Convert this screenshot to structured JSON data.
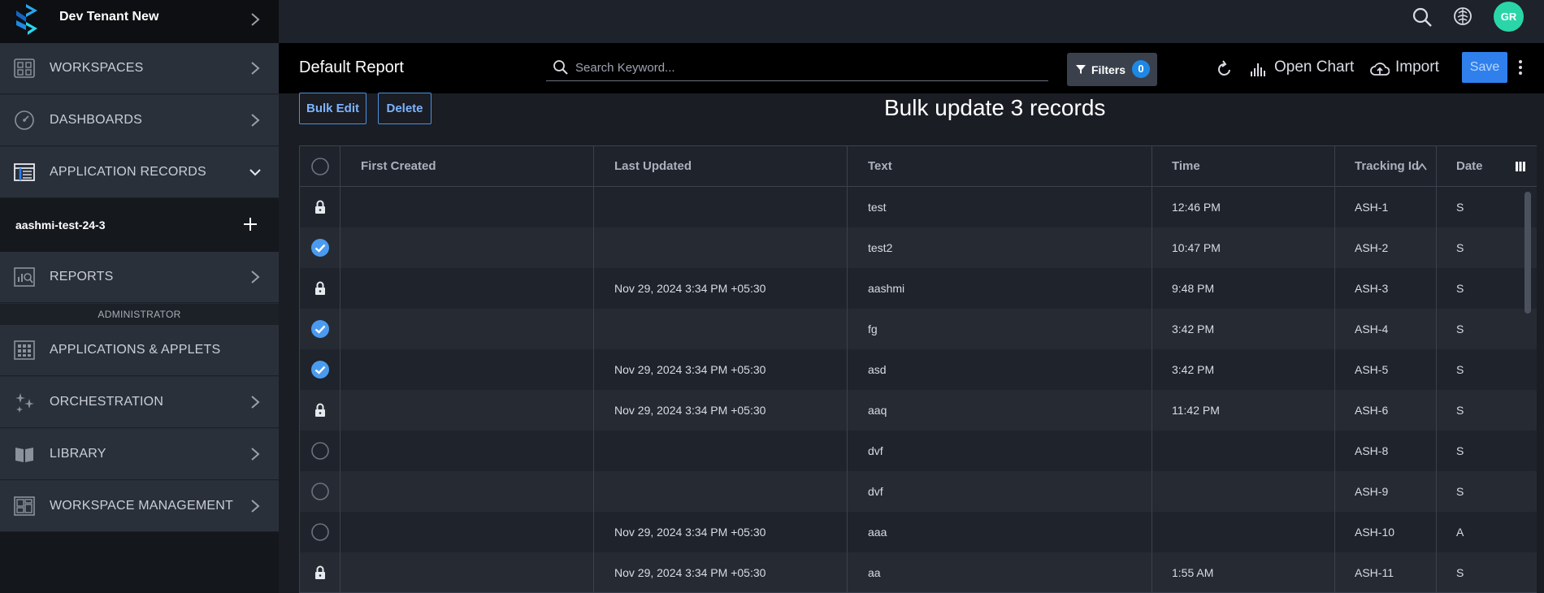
{
  "tenant": {
    "name": "Dev Tenant New"
  },
  "sidebar": {
    "items": [
      {
        "label": "WORKSPACES"
      },
      {
        "label": "DASHBOARDS"
      },
      {
        "label": "APPLICATION RECORDS"
      },
      {
        "label": "REPORTS"
      },
      {
        "label": "APPLICATIONS & APPLETS"
      },
      {
        "label": "ORCHESTRATION"
      },
      {
        "label": "LIBRARY"
      },
      {
        "label": "WORKSPACE MANAGEMENT"
      }
    ],
    "sub_item": "aashmi-test-24-3",
    "admin_header": "ADMINISTRATOR"
  },
  "topbar": {
    "avatar_initials": "GR"
  },
  "report": {
    "title": "Default Report",
    "search_placeholder": "Search Keyword...",
    "filters_label": "Filters",
    "filters_count": "0",
    "open_chart_label": "Open Chart",
    "import_label": "Import",
    "save_label": "Save"
  },
  "actions": {
    "bulk_edit_label": "Bulk Edit",
    "delete_label": "Delete",
    "bulk_title": "Bulk update 3 records"
  },
  "colors": {
    "accent": "#2f80ed",
    "avatar": "#2ad6a8",
    "check": "#4a9bf0"
  },
  "table": {
    "columns": [
      "First Created",
      "Last Updated",
      "Text",
      "Time",
      "Tracking Id",
      "Date"
    ],
    "rows": [
      {
        "state": "locked",
        "first_created": "",
        "last_updated": "",
        "text": "test",
        "time": "12:46 PM",
        "tracking_id": "ASH-1",
        "date": "S"
      },
      {
        "state": "checked",
        "first_created": "",
        "last_updated": "",
        "text": "test2",
        "time": "10:47 PM",
        "tracking_id": "ASH-2",
        "date": "S"
      },
      {
        "state": "locked",
        "first_created": "",
        "last_updated": "Nov 29, 2024 3:34 PM +05:30",
        "text": "aashmi",
        "time": "9:48 PM",
        "tracking_id": "ASH-3",
        "date": "S"
      },
      {
        "state": "checked",
        "first_created": "",
        "last_updated": "",
        "text": "fg",
        "time": "3:42 PM",
        "tracking_id": "ASH-4",
        "date": "S"
      },
      {
        "state": "checked",
        "first_created": "",
        "last_updated": "Nov 29, 2024 3:34 PM +05:30",
        "text": "asd",
        "time": "3:42 PM",
        "tracking_id": "ASH-5",
        "date": "S"
      },
      {
        "state": "locked",
        "first_created": "",
        "last_updated": "Nov 29, 2024 3:34 PM +05:30",
        "text": "aaq",
        "time": "11:42 PM",
        "tracking_id": "ASH-6",
        "date": "S"
      },
      {
        "state": "unchecked",
        "first_created": "",
        "last_updated": "",
        "text": "dvf",
        "time": "",
        "tracking_id": "ASH-8",
        "date": "S"
      },
      {
        "state": "unchecked",
        "first_created": "",
        "last_updated": "",
        "text": "dvf",
        "time": "",
        "tracking_id": "ASH-9",
        "date": "S"
      },
      {
        "state": "unchecked",
        "first_created": "",
        "last_updated": "Nov 29, 2024 3:34 PM +05:30",
        "text": "aaa",
        "time": "",
        "tracking_id": "ASH-10",
        "date": "A"
      },
      {
        "state": "locked",
        "first_created": "",
        "last_updated": "Nov 29, 2024 3:34 PM +05:30",
        "text": "aa",
        "time": "1:55 AM",
        "tracking_id": "ASH-11",
        "date": "S"
      }
    ]
  }
}
